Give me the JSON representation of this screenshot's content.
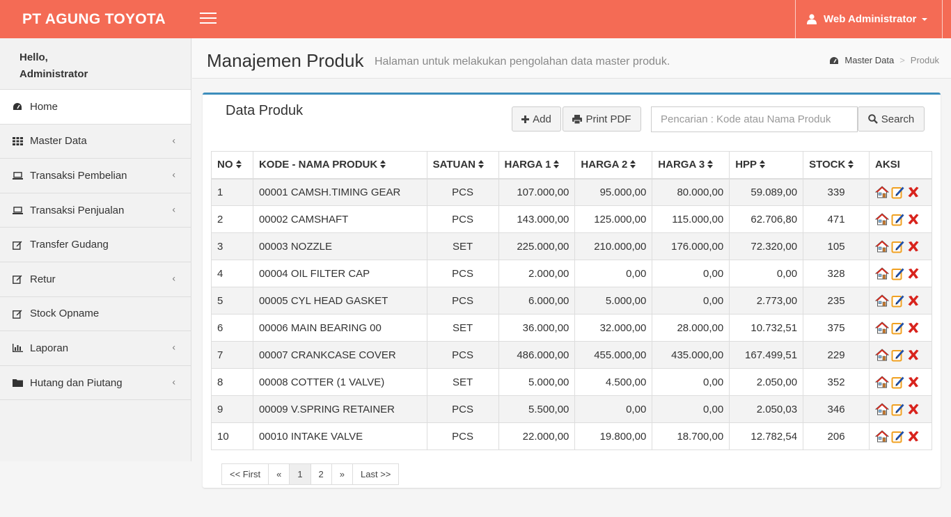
{
  "header": {
    "brand": "PT AGUNG TOYOTA",
    "user_label": "Web Administrator",
    "brand_color": "#f46b55"
  },
  "sidebar": {
    "hello_line1": "Hello,",
    "hello_line2": "Administrator",
    "items": [
      {
        "label": "Home",
        "icon": "dashboard-icon",
        "has_children": false,
        "active": true
      },
      {
        "label": "Master Data",
        "icon": "grid-icon",
        "has_children": true
      },
      {
        "label": "Transaksi Pembelian",
        "icon": "laptop-icon",
        "has_children": true
      },
      {
        "label": "Transaksi Penjualan",
        "icon": "laptop-icon",
        "has_children": true
      },
      {
        "label": "Transfer Gudang",
        "icon": "edit-icon",
        "has_children": false
      },
      {
        "label": "Retur",
        "icon": "edit-icon",
        "has_children": true
      },
      {
        "label": "Stock Opname",
        "icon": "edit-icon",
        "has_children": false
      },
      {
        "label": "Laporan",
        "icon": "bar-chart-icon",
        "has_children": true
      },
      {
        "label": "Hutang dan Piutang",
        "icon": "folder-icon",
        "has_children": true
      }
    ]
  },
  "page": {
    "title": "Manajemen Produk",
    "subtitle": "Halaman untuk melakukan pengolahan data master produk.",
    "breadcrumb": [
      "Master Data",
      "Produk"
    ]
  },
  "box": {
    "title": "Data Produk",
    "add_label": "Add",
    "pdf_label": "Print PDF",
    "search_placeholder": "Pencarian : Kode atau Nama Produk",
    "search_label": "Search",
    "accent_color": "#3c8dbc"
  },
  "table": {
    "columns": [
      "NO",
      "KODE - NAMA PRODUK",
      "SATUAN",
      "HARGA 1",
      "HARGA 2",
      "HARGA 3",
      "HPP",
      "STOCK",
      "AKSI"
    ],
    "rows": [
      [
        "1",
        "00001 CAMSH.TIMING GEAR",
        "PCS",
        "107.000,00",
        "95.000,00",
        "80.000,00",
        "59.089,00",
        "339"
      ],
      [
        "2",
        "00002 CAMSHAFT",
        "PCS",
        "143.000,00",
        "125.000,00",
        "115.000,00",
        "62.706,80",
        "471"
      ],
      [
        "3",
        "00003 NOZZLE",
        "SET",
        "225.000,00",
        "210.000,00",
        "176.000,00",
        "72.320,00",
        "105"
      ],
      [
        "4",
        "00004 OIL FILTER CAP",
        "PCS",
        "2.000,00",
        "0,00",
        "0,00",
        "0,00",
        "328"
      ],
      [
        "5",
        "00005 CYL HEAD GASKET",
        "PCS",
        "6.000,00",
        "5.000,00",
        "0,00",
        "2.773,00",
        "235"
      ],
      [
        "6",
        "00006 MAIN BEARING 00",
        "SET",
        "36.000,00",
        "32.000,00",
        "28.000,00",
        "10.732,51",
        "375"
      ],
      [
        "7",
        "00007 CRANKCASE COVER",
        "PCS",
        "486.000,00",
        "455.000,00",
        "435.000,00",
        "167.499,51",
        "229"
      ],
      [
        "8",
        "00008 COTTER (1 VALVE)",
        "SET",
        "5.000,00",
        "4.500,00",
        "0,00",
        "2.050,00",
        "352"
      ],
      [
        "9",
        "00009 V.SPRING RETAINER",
        "PCS",
        "5.500,00",
        "0,00",
        "0,00",
        "2.050,03",
        "346"
      ],
      [
        "10",
        "00010 INTAKE VALVE",
        "PCS",
        "22.000,00",
        "19.800,00",
        "18.700,00",
        "12.782,54",
        "206"
      ]
    ]
  },
  "pagination": [
    "<< First",
    "«",
    "1",
    "2",
    "»",
    "Last >>"
  ],
  "pagination_active": "1"
}
